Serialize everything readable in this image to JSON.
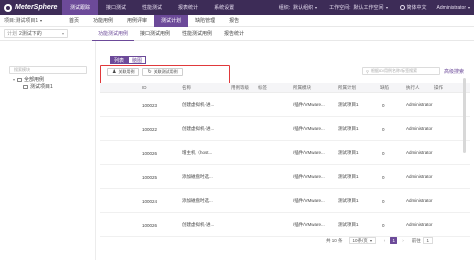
{
  "app": {
    "name": "MeterSphere"
  },
  "topnav": {
    "tabs": [
      {
        "label": "测试跟踪",
        "active": true
      },
      {
        "label": "接口测试",
        "active": false
      },
      {
        "label": "性能测试",
        "active": false
      },
      {
        "label": "报表统计",
        "active": false
      },
      {
        "label": "系统设置",
        "active": false
      }
    ],
    "org_label": "组织:",
    "org_value": "默认组织",
    "workspace_label": "工作空间:",
    "workspace_value": "默认工作空间",
    "lang": "简体中文",
    "user": "Administrator"
  },
  "subnav": {
    "project_label": "项目:",
    "project_value": "测试项目1",
    "tabs": [
      {
        "label": "首页",
        "active": false
      },
      {
        "label": "功能用例",
        "active": false
      },
      {
        "label": "用例评审",
        "active": false
      },
      {
        "label": "测试计划",
        "active": true
      },
      {
        "label": "缺陷管理",
        "active": false
      },
      {
        "label": "报告",
        "active": false
      }
    ]
  },
  "thirdnav": {
    "version_prefix": "计划",
    "version_value": "2测试下的",
    "tabs": [
      {
        "label": "功能测试用例",
        "active": true
      },
      {
        "label": "接口测试用例",
        "active": false
      },
      {
        "label": "性能测试用例",
        "active": false
      },
      {
        "label": "报告统计",
        "active": false
      }
    ]
  },
  "sidebar": {
    "search_placeholder": "搜索模块",
    "root": "全部用例",
    "child": "测试项目1"
  },
  "view_tabs": [
    {
      "label": "列表",
      "active": true
    },
    {
      "label": "脑图",
      "active": false
    }
  ],
  "toolbar": {
    "related_case": "关联用例",
    "related_plan": "关联测试用例"
  },
  "filter": {
    "placeholder": "根据ID/用例名称/标签搜索",
    "advanced": "高级搜索"
  },
  "table": {
    "columns": [
      "ID",
      "名称",
      "用例等级",
      "标签",
      "所属模块",
      "所属计划",
      "缺陷",
      "执行人",
      "操作"
    ],
    "rows": [
      {
        "id": "100023",
        "name": "创建虚拟机-进...",
        "priority": "P1",
        "module": "/插件/VMware...",
        "plan": "测试项目1",
        "bug": "0",
        "executor": "Administrator"
      },
      {
        "id": "100022",
        "name": "创建虚拟机-进...",
        "priority": "P1",
        "module": "/插件/VMware...",
        "plan": "测试项目1",
        "bug": "0",
        "executor": "Administrator"
      },
      {
        "id": "100026",
        "name": "增主机（host...",
        "priority": "P1",
        "module": "/插件/VMware...",
        "plan": "测试项目1",
        "bug": "0",
        "executor": "Administrator"
      },
      {
        "id": "100025",
        "name": "添加磁盘时选...",
        "priority": "P1",
        "module": "/插件/VMware...",
        "plan": "测试项目1",
        "bug": "0",
        "executor": "Administrator"
      },
      {
        "id": "100024",
        "name": "添加磁盘时选...",
        "priority": "P1",
        "module": "/插件/VMware...",
        "plan": "测试项目1",
        "bug": "0",
        "executor": "Administrator"
      },
      {
        "id": "100026",
        "name": "创建虚拟机-进...",
        "priority": "P1",
        "module": "/插件/VMware...",
        "plan": "测试项目1",
        "bug": "0",
        "executor": "Administrator"
      }
    ]
  },
  "pager": {
    "total": "共 10 条",
    "page_size": "10条/页",
    "page": "1",
    "goto": "前往",
    "goto_value": "1"
  },
  "colors": {
    "brand": "#3d2c57",
    "accent": "#6c4a99",
    "highlight": "#e0393b"
  }
}
